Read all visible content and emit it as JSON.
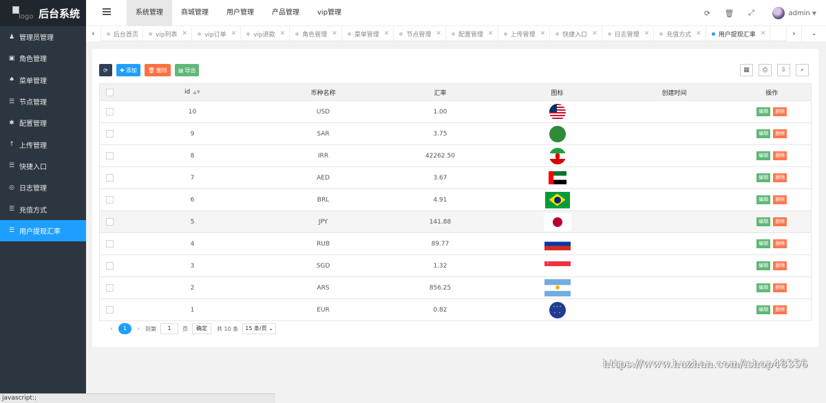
{
  "brand": {
    "logo_alt": "logo",
    "title": "后台系统"
  },
  "sidebar": {
    "items": [
      {
        "label": "管理员管理",
        "icon": "user-icon"
      },
      {
        "label": "角色管理",
        "icon": "id-card-icon"
      },
      {
        "label": "菜单管理",
        "icon": "bell-icon"
      },
      {
        "label": "节点管理",
        "icon": "list-icon"
      },
      {
        "label": "配置管理",
        "icon": "gear-icon"
      },
      {
        "label": "上传管理",
        "icon": "upload-icon"
      },
      {
        "label": "快捷入口",
        "icon": "list-icon"
      },
      {
        "label": "日志管理",
        "icon": "clock-icon"
      },
      {
        "label": "充值方式",
        "icon": "list-icon"
      },
      {
        "label": "用户提现汇率",
        "icon": "list-icon",
        "active": true
      }
    ]
  },
  "status_bar": "javascript:;",
  "header": {
    "nav": [
      "系统管理",
      "商城管理",
      "用户管理",
      "产品管理",
      "vip管理"
    ],
    "active_nav": 0,
    "user_name": "admin"
  },
  "tabs": [
    "后台首页",
    "vip列表",
    "vip订单",
    "vip退款",
    "角色管理",
    "菜单管理",
    "节点管理",
    "配置管理",
    "上传管理",
    "快捷入口",
    "日志管理",
    "充值方式",
    "用户提现汇率"
  ],
  "toolbar": {
    "add": "添加",
    "delete": "删除",
    "export": "导出"
  },
  "table": {
    "columns": [
      "id",
      "币种名称",
      "汇率",
      "图标",
      "创建时间",
      "操作"
    ],
    "rows": [
      {
        "id": "10",
        "currency": "USD",
        "rate": "1.00",
        "flag": "f-usd round",
        "created": ""
      },
      {
        "id": "9",
        "currency": "SAR",
        "rate": "3.75",
        "flag": "f-sar round",
        "created": ""
      },
      {
        "id": "8",
        "currency": "IRR",
        "rate": "42262.50",
        "flag": "f-irr round",
        "created": ""
      },
      {
        "id": "7",
        "currency": "AED",
        "rate": "3.67",
        "flag": "f-aed rect",
        "created": ""
      },
      {
        "id": "6",
        "currency": "BRL",
        "rate": "4.91",
        "flag": "f-brl rect",
        "created": ""
      },
      {
        "id": "5",
        "currency": "JPY",
        "rate": "141.88",
        "flag": "f-jpy rect",
        "created": ""
      },
      {
        "id": "4",
        "currency": "RUB",
        "rate": "89.77",
        "flag": "f-rub rect",
        "created": ""
      },
      {
        "id": "3",
        "currency": "SGD",
        "rate": "1.32",
        "flag": "f-sgd rect",
        "created": ""
      },
      {
        "id": "2",
        "currency": "ARS",
        "rate": "856.25",
        "flag": "f-ars rect",
        "created": ""
      },
      {
        "id": "1",
        "currency": "EUR",
        "rate": "0.82",
        "flag": "f-eur round",
        "created": ""
      }
    ],
    "edit_label": "编辑",
    "delete_label": "删除",
    "highlighted_row": 5
  },
  "pager": {
    "current": "1",
    "goto_label": "到第",
    "page_value": "1",
    "page_unit": "页",
    "confirm": "确定",
    "total": "共 10 条",
    "page_size": "15 条/页"
  },
  "watermark": "https://www.huzhan.com/ishop48356",
  "colors": {
    "sidebar_bg": "#2c3640",
    "accent": "#1e9fff",
    "edit": "#5fb878",
    "danger": "#ff5722"
  }
}
